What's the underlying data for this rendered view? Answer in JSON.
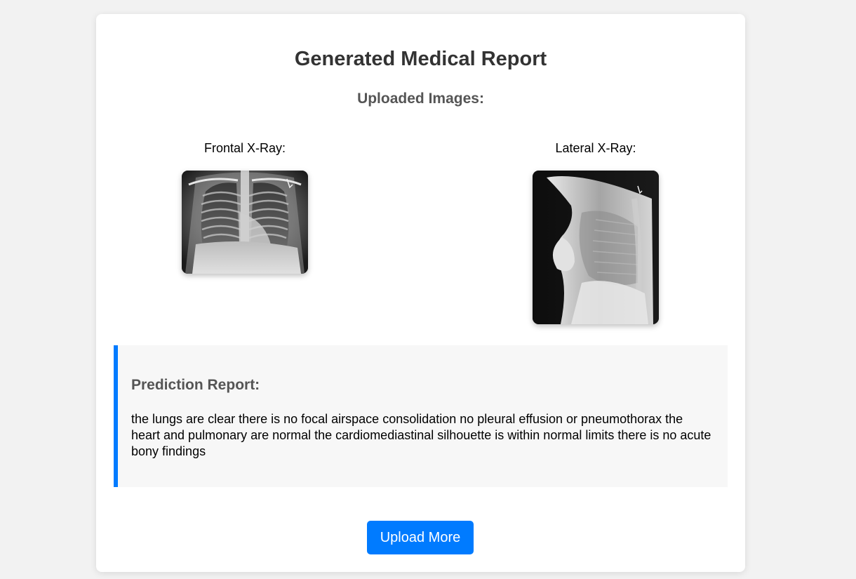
{
  "page": {
    "title": "Generated Medical Report",
    "uploaded_heading": "Uploaded Images:"
  },
  "images": {
    "frontal_label": "Frontal X-Ray:",
    "lateral_label": "Lateral X-Ray:"
  },
  "report": {
    "heading": "Prediction Report:",
    "text": "the lungs are clear there is no focal airspace consolidation no pleural effusion or pneumothorax the heart and pulmonary are normal the cardiomediastinal silhouette is within normal limits there is no acute bony findings"
  },
  "actions": {
    "upload_more_label": "Upload More"
  },
  "colors": {
    "accent": "#007bff",
    "background": "#f2f2f2",
    "card": "#ffffff",
    "report_bg": "#f7f7f7"
  }
}
